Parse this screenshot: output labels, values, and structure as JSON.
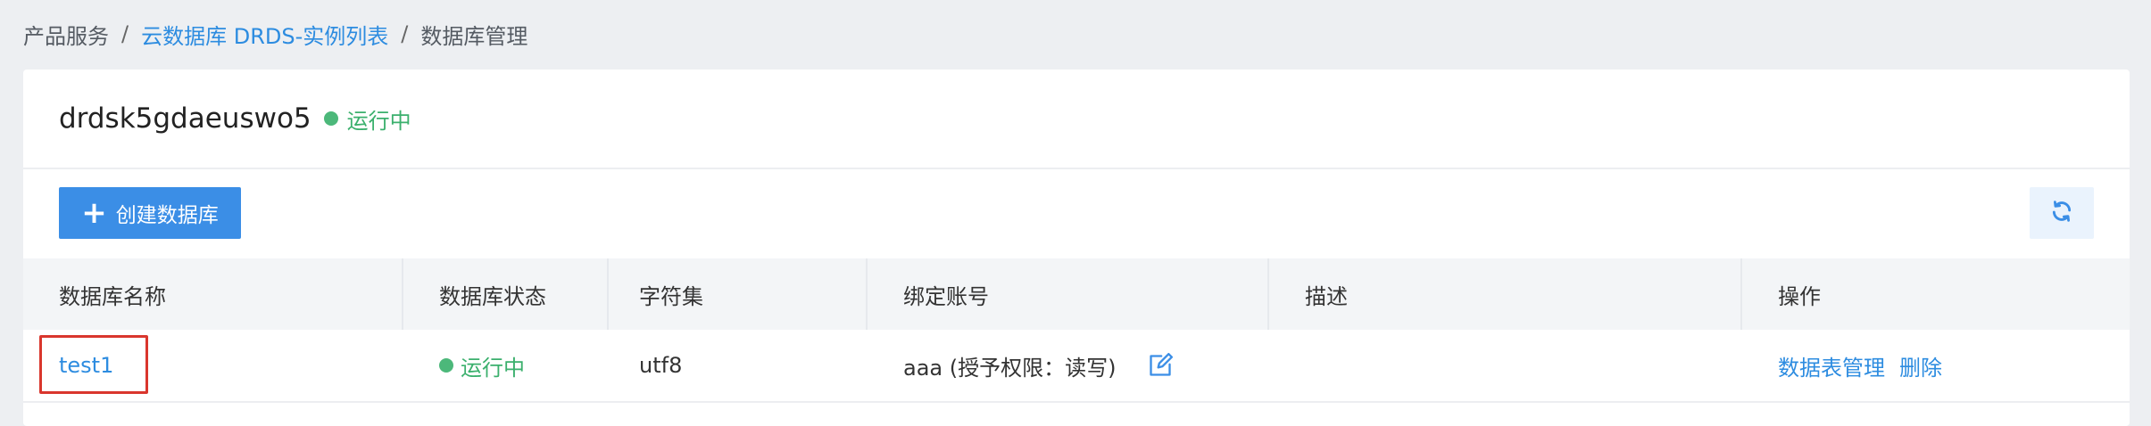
{
  "breadcrumb": {
    "item1": "产品服务",
    "item2": "云数据库 DRDS-实例列表",
    "item3": "数据库管理",
    "sep": "/"
  },
  "instance": {
    "name": "drdsk5gdaeuswo5",
    "status": "运行中",
    "status_color": "#4cb87a"
  },
  "toolbar": {
    "create_label": "创建数据库",
    "plus_glyph": "+"
  },
  "table": {
    "headers": [
      "数据库名称",
      "数据库状态",
      "字符集",
      "绑定账号",
      "描述",
      "操作"
    ],
    "rows": [
      {
        "name": "test1",
        "status": "运行中",
        "charset": "utf8",
        "account": "aaa (授予权限：读写)",
        "description": "",
        "actions": [
          "数据表管理",
          "删除"
        ]
      }
    ]
  },
  "colors": {
    "accent": "#3b8ee6",
    "link": "#2d8ce0",
    "success": "#3bb06d",
    "highlight": "#d9362d"
  },
  "icons": {
    "refresh": "refresh-icon",
    "edit": "edit-icon",
    "plus": "plus-icon"
  }
}
